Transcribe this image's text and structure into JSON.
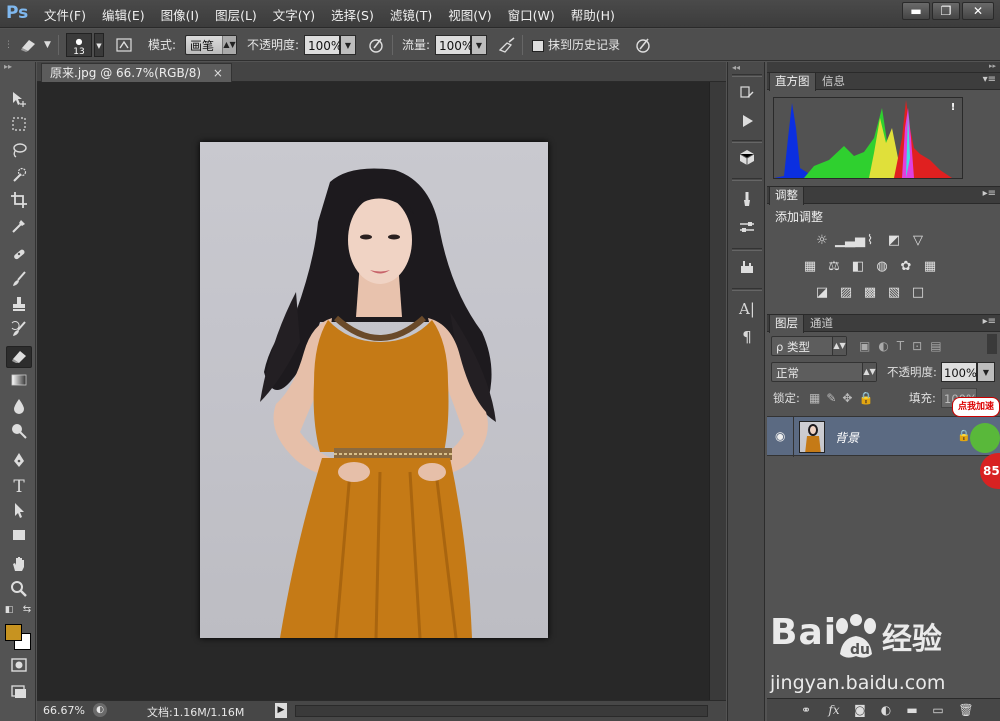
{
  "app": {
    "logo": "Ps"
  },
  "menu": [
    "文件(F)",
    "编辑(E)",
    "图像(I)",
    "图层(L)",
    "文字(Y)",
    "选择(S)",
    "滤镜(T)",
    "视图(V)",
    "窗口(W)",
    "帮助(H)"
  ],
  "window_controls": {
    "minimize": "▬",
    "restore": "❐",
    "close": "✕"
  },
  "options": {
    "brush_size": "13",
    "mode_label": "模式:",
    "mode_value": "画笔",
    "opacity_label": "不透明度:",
    "opacity_value": "100%",
    "flow_label": "流量:",
    "flow_value": "100%",
    "history_label": "抹到历史记录"
  },
  "document": {
    "tab_title": "原来.jpg @ 66.7%(RGB/8)",
    "tab_close": "×",
    "zoom": "66.67%",
    "doc_info": "文档:1.16M/1.16M"
  },
  "colors": {
    "foreground": "#c79320",
    "background": "#ffffff",
    "dress": "#c57a16"
  },
  "panels": {
    "histogram": {
      "tabs": [
        "直方图",
        "信息"
      ],
      "warning": "!"
    },
    "adjustments": {
      "tab": "调整",
      "title": "添加调整"
    },
    "layers": {
      "tabs": [
        "图层",
        "通道"
      ],
      "filter_label": "ρ 类型",
      "blend_mode": "正常",
      "opacity_label": "不透明度:",
      "opacity_value": "100%",
      "lock_label": "锁定:",
      "fill_label": "填充:",
      "fill_value": "100%",
      "layer_name": "背景"
    }
  },
  "overlays": {
    "speed_badge_text": "点我加速",
    "speed_value": "85",
    "watermark_logo": "Bai",
    "watermark_logo_cn": "经验",
    "watermark_url": "jingyan.baidu.com"
  }
}
